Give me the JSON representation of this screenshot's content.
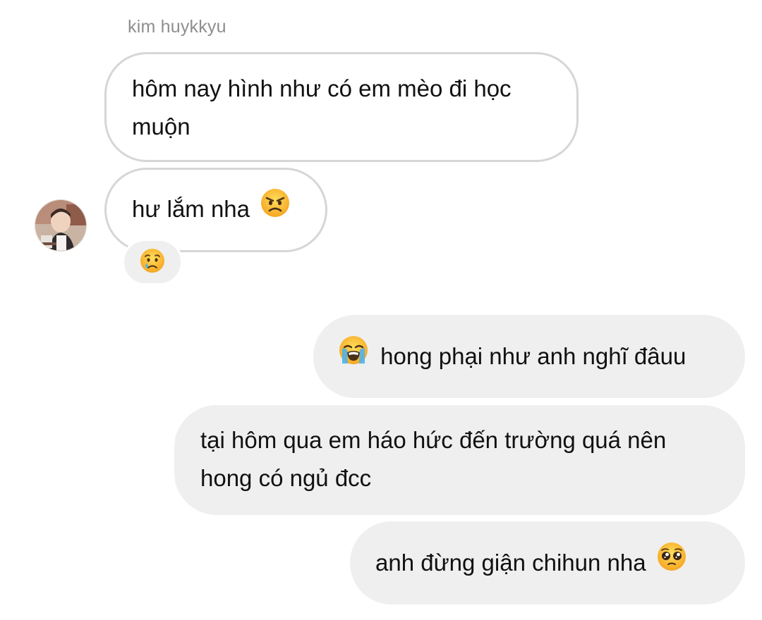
{
  "sender": {
    "name": "kim huykkyu",
    "avatar_icon": "profile-photo"
  },
  "messages": [
    {
      "direction": "incoming",
      "text": "hôm nay hình như có em mèo đi học muộn"
    },
    {
      "direction": "incoming",
      "text": "hư lắm nha",
      "emoji": "angry-face-icon"
    },
    {
      "direction": "outgoing",
      "text": "hong phại như anh nghĩ đâuu",
      "emoji": "loudly-crying-face-icon"
    },
    {
      "direction": "outgoing",
      "text": "tại hôm qua em háo hức đến trường quá nên hong có ngủ đcc"
    },
    {
      "direction": "outgoing",
      "text": "anh đừng giận chihun nha",
      "emoji": "pleading-face-icon"
    }
  ],
  "reaction": {
    "emoji": "crying-face-icon"
  },
  "colors": {
    "incoming_border": "#d6d6d6",
    "outgoing_bg": "#efefef",
    "name_text": "#8e8e8e",
    "emoji_yellow": "#fcc21b"
  }
}
